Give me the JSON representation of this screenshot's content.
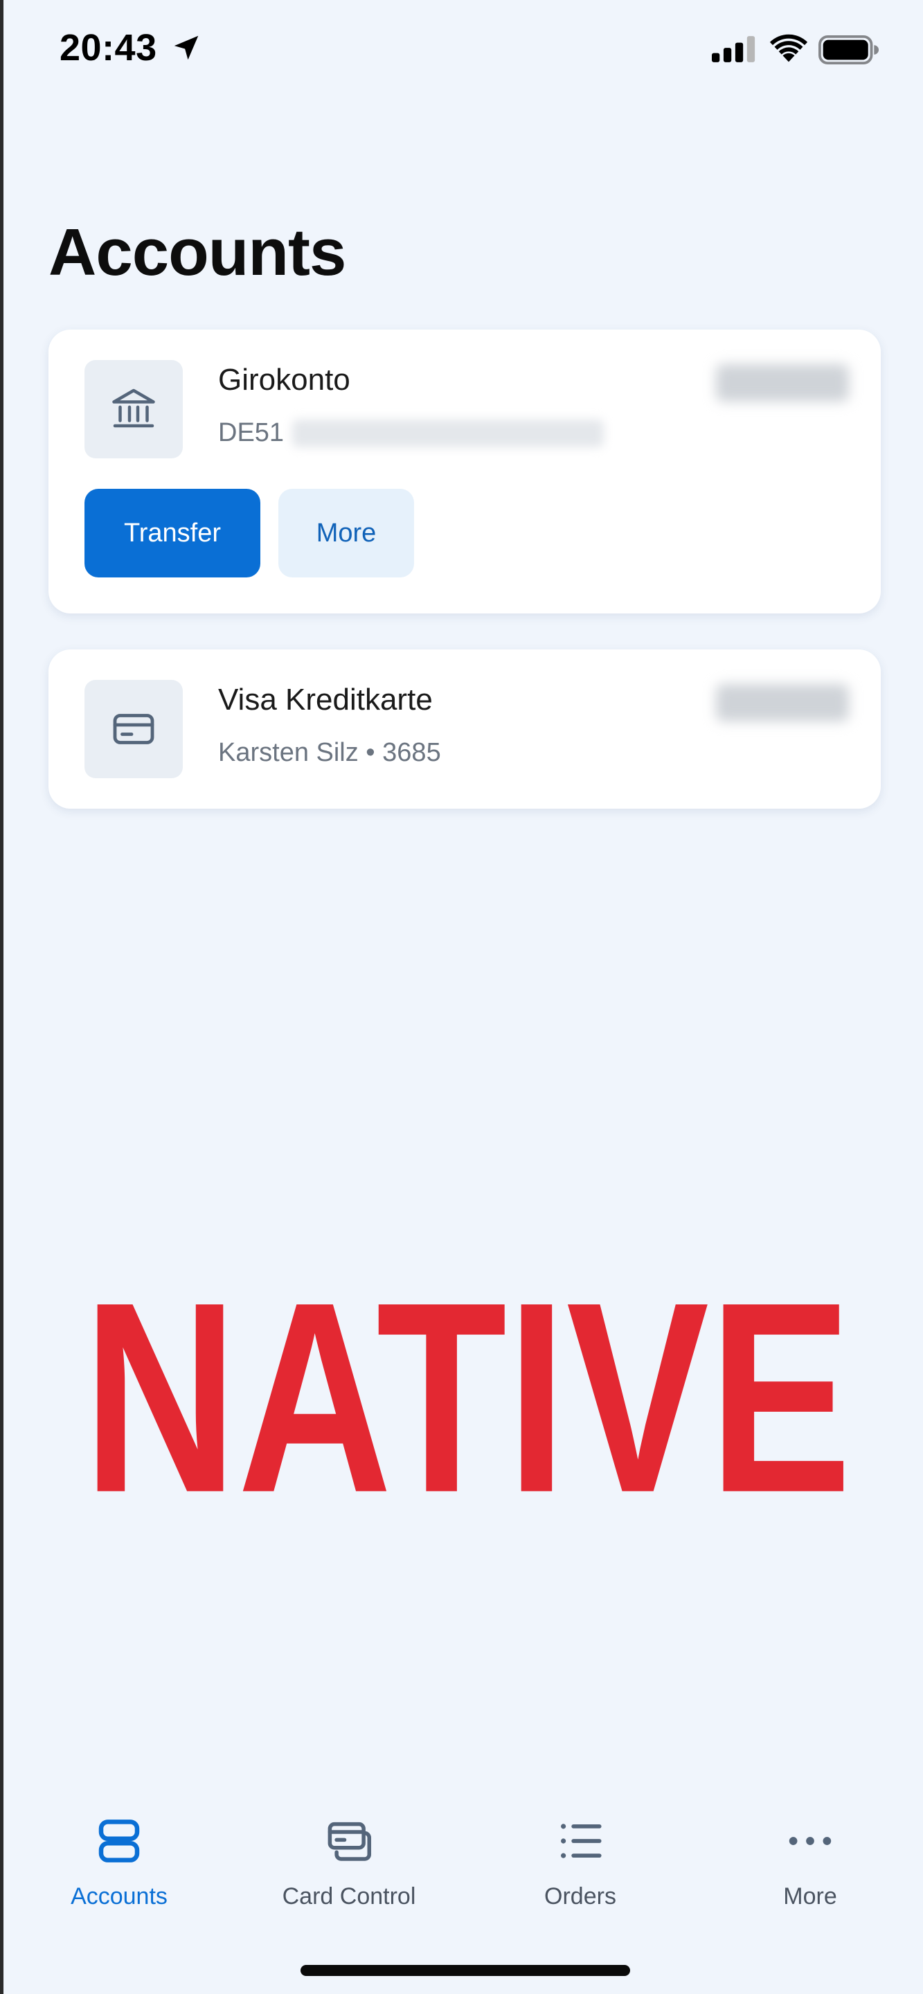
{
  "status_bar": {
    "time": "20:43"
  },
  "page": {
    "title": "Accounts"
  },
  "accounts": [
    {
      "name": "Girokonto",
      "iban_prefix": "DE51",
      "icon": "bank-icon",
      "actions": {
        "transfer": "Transfer",
        "more": "More"
      }
    },
    {
      "name": "Visa Kreditkarte",
      "holder": "Karsten Silz • 3685",
      "icon": "credit-card-icon"
    }
  ],
  "overlay": {
    "text": "NATIVE",
    "color": "#e32832"
  },
  "tab_bar": {
    "items": [
      {
        "label": "Accounts",
        "icon": "accounts-icon",
        "active": true
      },
      {
        "label": "Card Control",
        "icon": "card-control-icon",
        "active": false
      },
      {
        "label": "Orders",
        "icon": "orders-icon",
        "active": false
      },
      {
        "label": "More",
        "icon": "more-dots-icon",
        "active": false
      }
    ]
  },
  "colors": {
    "background": "#f0f5fc",
    "primary": "#0a6fd5",
    "secondary_button_bg": "#e6f1fb",
    "icon_gray": "#54657a"
  }
}
